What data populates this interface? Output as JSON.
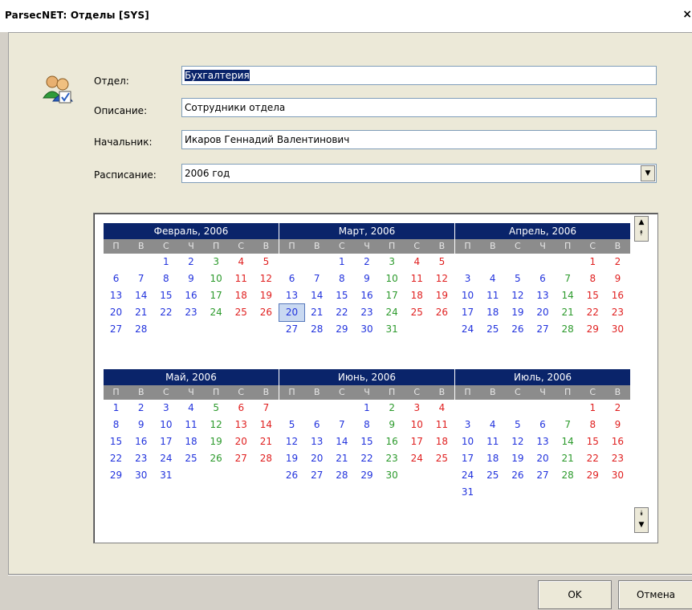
{
  "window": {
    "title": "ParsecNET: Отделы [SYS]",
    "close_glyph": "×"
  },
  "form": {
    "dept_label": "Отдел:",
    "dept_value": "Бухгалтерия",
    "desc_label": "Описание:",
    "desc_value": "Сотрудники отдела",
    "head_label": "Начальник:",
    "head_value": "Икаров Геннадий Валентинович",
    "schedule_label": "Расписание:",
    "schedule_value": "2006 год"
  },
  "calendar": {
    "weekdays": [
      "П",
      "В",
      "С",
      "Ч",
      "П",
      "С",
      "В"
    ],
    "today_month": 1,
    "today_day": 20,
    "months": [
      {
        "title": "Февраль, 2006",
        "offset": 2,
        "days": 28,
        "holidays": []
      },
      {
        "title": "Март, 2006",
        "offset": 2,
        "days": 31,
        "holidays": []
      },
      {
        "title": "Апрель, 2006",
        "offset": 5,
        "days": 30,
        "holidays": []
      },
      {
        "title": "Май, 2006",
        "offset": 0,
        "days": 31,
        "holidays": []
      },
      {
        "title": "Июнь, 2006",
        "offset": 3,
        "days": 30,
        "holidays": []
      },
      {
        "title": "Июль, 2006",
        "offset": 5,
        "days": 31,
        "holidays": []
      }
    ]
  },
  "buttons": {
    "ok": "OK",
    "cancel": "Отмена"
  }
}
